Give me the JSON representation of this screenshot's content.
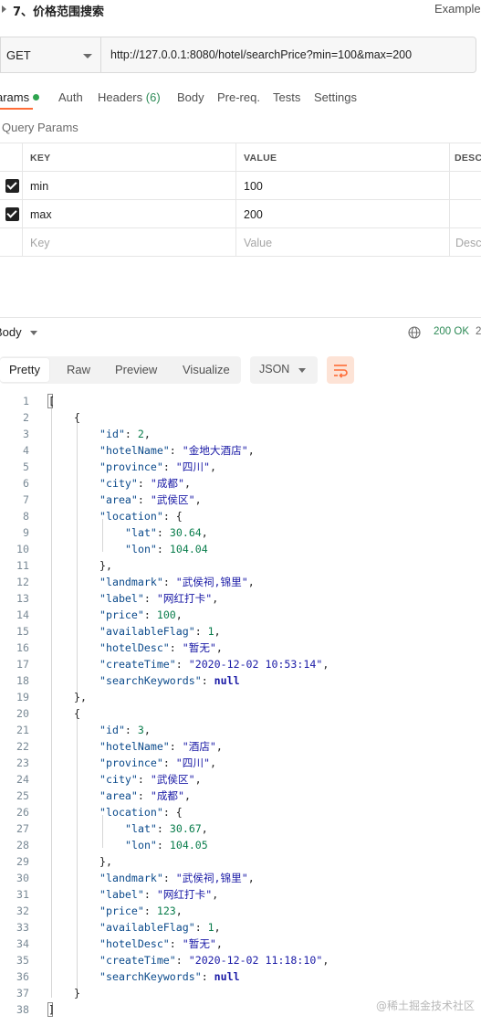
{
  "request": {
    "title": "7、价格范围搜索",
    "examples_label": "Examples",
    "method": "GET",
    "url": "http://127.0.0.1:8080/hotel/searchPrice?min=100&max=200"
  },
  "tabs": [
    {
      "label": "arams"
    },
    {
      "label": "Auth"
    },
    {
      "label": "Headers",
      "count": "(6)"
    },
    {
      "label": "Body"
    },
    {
      "label": "Pre-req."
    },
    {
      "label": "Tests"
    },
    {
      "label": "Settings"
    }
  ],
  "query_params": {
    "title": "Query Params",
    "headers": {
      "key": "KEY",
      "value": "VALUE",
      "desc": "DESCR"
    },
    "rows": [
      {
        "key": "min",
        "value": "100",
        "checked": true
      },
      {
        "key": "max",
        "value": "200",
        "checked": true
      }
    ],
    "placeholder": {
      "key": "Key",
      "value": "Value",
      "desc": "Desc"
    }
  },
  "response": {
    "title": "Body",
    "status": "200 OK",
    "status_color": "#2e8b57",
    "trailing": "2",
    "views": [
      "Pretty",
      "Raw",
      "Preview",
      "Visualize"
    ],
    "active_view": "Pretty",
    "format": "JSON"
  },
  "json_hotels": [
    {
      "id": 2,
      "hotelName": "金地大酒店",
      "province": "四川",
      "city": "成都",
      "area": "武侯区",
      "lat": "30.64",
      "lon": "104.04",
      "landmark": "武侯祠,锦里",
      "label": "网红打卡",
      "price": 100,
      "availableFlag": 1,
      "hotelDesc": "暂无",
      "createTime": "2020-12-02 10:53:14",
      "searchKeywords": "null"
    },
    {
      "id": 3,
      "hotelName": "酒店",
      "province": "四川",
      "city": "武侯区",
      "area": "成都",
      "lat": "30.67",
      "lon": "104.05",
      "landmark": "武侯祠,锦里",
      "label": "网红打卡",
      "price": 123,
      "availableFlag": 1,
      "hotelDesc": "暂无",
      "createTime": "2020-12-02 11:18:10",
      "searchKeywords": "null"
    }
  ],
  "watermark": "@稀土掘金技术社区"
}
